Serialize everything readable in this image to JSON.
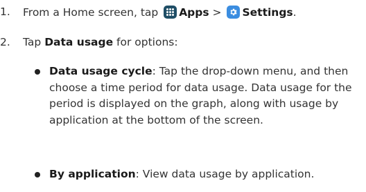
{
  "steps": [
    {
      "number": "1.",
      "prefix": "From a Home screen, tap",
      "apps_label": "Apps",
      "separator": ">",
      "settings_label": "Settings",
      "suffix": "."
    },
    {
      "number": "2.",
      "prefix": "Tap",
      "bold": "Data usage",
      "suffix": "for options:"
    }
  ],
  "bullets": [
    {
      "term": "Data usage cycle",
      "description": ": Tap the drop-down menu, and then choose a time period for data usage. Data usage for the period is displayed on the graph, along with usage by application at the bottom of the screen."
    },
    {
      "term": "By application",
      "description": ": View data usage by application."
    }
  ],
  "icons": {
    "apps": "apps-grid-icon",
    "settings": "gear-icon"
  },
  "colors": {
    "apps_icon_bg": "#1f4e66",
    "settings_icon_bg": "#3b8de0"
  }
}
